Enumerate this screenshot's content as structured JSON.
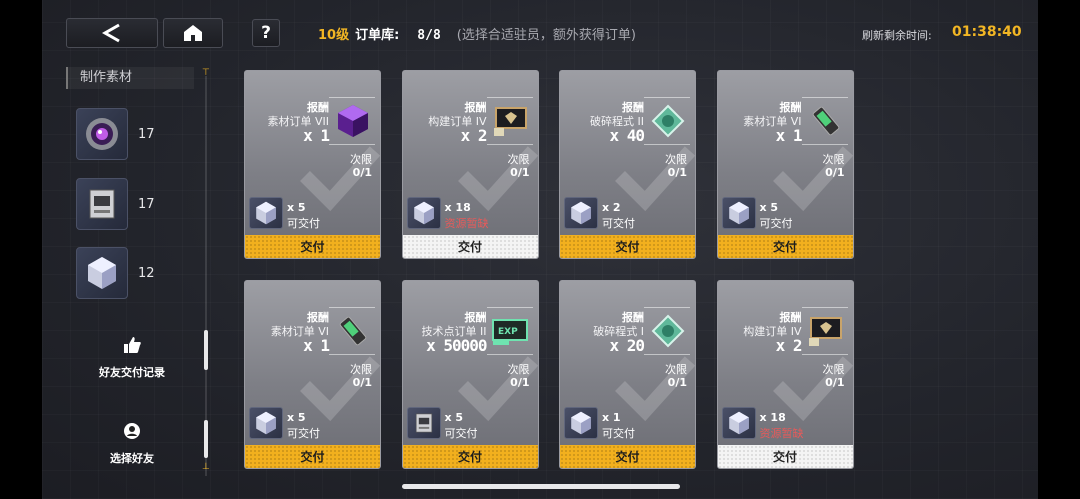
{
  "header": {
    "level": "10级",
    "library": "订单库:",
    "count": "8/8",
    "hint": "(选择合适驻员，额外获得订单)",
    "refresh_label": "刷新剩余时间:",
    "refresh_time": "01:38:40"
  },
  "sidebar": {
    "materials_title": "制作素材",
    "materials": [
      {
        "icon": "purple-orb-icon",
        "count": "17"
      },
      {
        "icon": "data-chip-icon",
        "count": "17"
      },
      {
        "icon": "crystal-cube-icon",
        "count": "12"
      }
    ],
    "friend_records": "好友交付记录",
    "select_friend": "选择好友"
  },
  "cards": [
    {
      "reward_label": "报酬",
      "order_name": "素材订单 VII",
      "qty": "x 1",
      "reward_icon": "purple-gem-icon",
      "limit_label": "次限",
      "limit": "0/1",
      "req_icon": "crystal-cube-icon",
      "req_qty": "x 5",
      "req_status": "可交付",
      "short": false,
      "button": "交付"
    },
    {
      "reward_label": "报酬",
      "order_name": "构建订单 IV",
      "qty": "x 2",
      "reward_icon": "card-pack-icon",
      "limit_label": "次限",
      "limit": "0/1",
      "req_icon": "crystal-cube-icon",
      "req_qty": "x 18",
      "req_status": "资源暂缺",
      "short": true,
      "button": "交付"
    },
    {
      "reward_label": "报酬",
      "order_name": "破碎程式 II",
      "qty": "x 40",
      "reward_icon": "green-chip-icon",
      "limit_label": "次限",
      "limit": "0/1",
      "req_icon": "crystal-cube-icon",
      "req_qty": "x 2",
      "req_status": "可交付",
      "short": false,
      "button": "交付"
    },
    {
      "reward_label": "报酬",
      "order_name": "素材订单 VI",
      "qty": "x 1",
      "reward_icon": "battery-icon",
      "limit_label": "次限",
      "limit": "0/1",
      "req_icon": "crystal-cube-icon",
      "req_qty": "x 5",
      "req_status": "可交付",
      "short": false,
      "button": "交付"
    },
    {
      "reward_label": "报酬",
      "order_name": "素材订单 VI",
      "qty": "x 1",
      "reward_icon": "battery-icon",
      "limit_label": "次限",
      "limit": "0/1",
      "req_icon": "crystal-cube-icon",
      "req_qty": "x 5",
      "req_status": "可交付",
      "short": false,
      "button": "交付"
    },
    {
      "reward_label": "报酬",
      "order_name": "技术点订单 II",
      "qty": "x 50000",
      "reward_icon": "exp-ticket-icon",
      "limit_label": "次限",
      "limit": "0/1",
      "req_icon": "data-chip-icon",
      "req_qty": "x 5",
      "req_status": "可交付",
      "short": false,
      "button": "交付"
    },
    {
      "reward_label": "报酬",
      "order_name": "破碎程式 I",
      "qty": "x 20",
      "reward_icon": "green-chip-icon",
      "limit_label": "次限",
      "limit": "0/1",
      "req_icon": "crystal-cube-icon",
      "req_qty": "x 1",
      "req_status": "可交付",
      "short": false,
      "button": "交付"
    },
    {
      "reward_label": "报酬",
      "order_name": "构建订单 IV",
      "qty": "x 2",
      "reward_icon": "card-pack-icon",
      "limit_label": "次限",
      "limit": "0/1",
      "req_icon": "crystal-cube-icon",
      "req_qty": "x 18",
      "req_status": "资源暂缺",
      "short": true,
      "button": "交付"
    }
  ]
}
